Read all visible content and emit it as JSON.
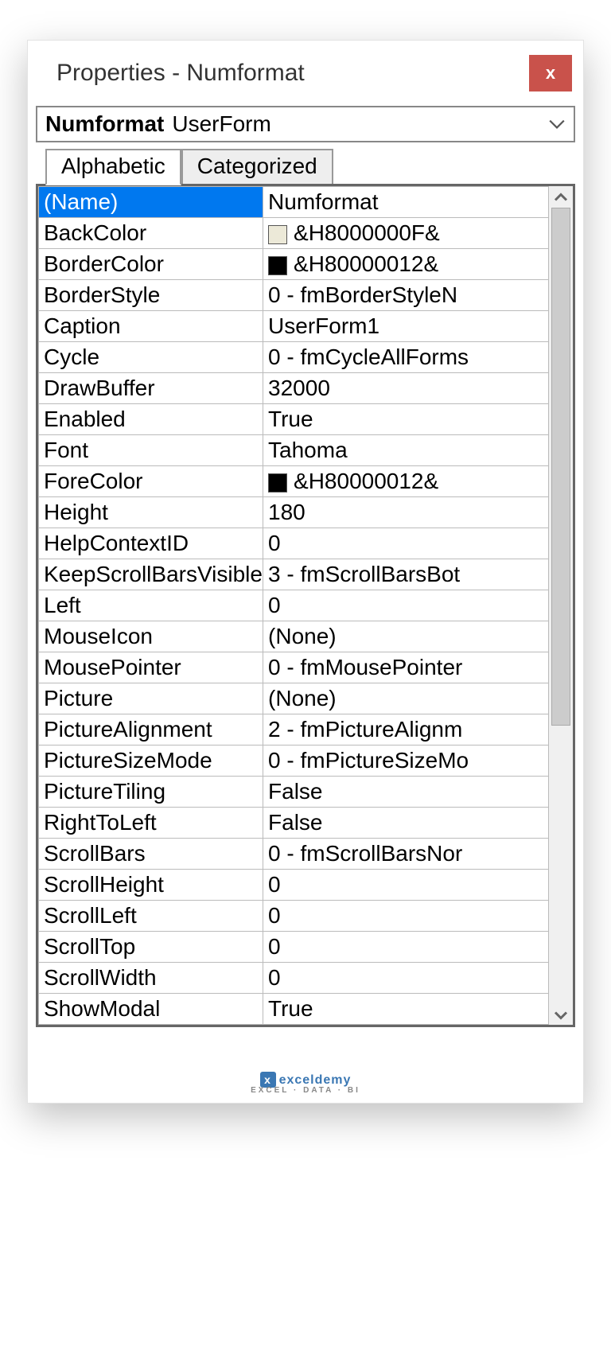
{
  "window": {
    "title": "Properties - Numformat",
    "close_label": "x"
  },
  "object_dropdown": {
    "name": "Numformat",
    "type": "UserForm"
  },
  "tabs": {
    "alphabetic": "Alphabetic",
    "categorized": "Categorized"
  },
  "properties": [
    {
      "name": "(Name)",
      "value": "Numformat",
      "selected": true
    },
    {
      "name": "BackColor",
      "value": "&H8000000F&",
      "swatch": "#ece9d8"
    },
    {
      "name": "BorderColor",
      "value": "&H80000012&",
      "swatch": "#000000"
    },
    {
      "name": "BorderStyle",
      "value": "0 - fmBorderStyleN"
    },
    {
      "name": "Caption",
      "value": "UserForm1"
    },
    {
      "name": "Cycle",
      "value": "0 - fmCycleAllForms"
    },
    {
      "name": "DrawBuffer",
      "value": "32000"
    },
    {
      "name": "Enabled",
      "value": "True"
    },
    {
      "name": "Font",
      "value": "Tahoma"
    },
    {
      "name": "ForeColor",
      "value": "&H80000012&",
      "swatch": "#000000"
    },
    {
      "name": "Height",
      "value": "180"
    },
    {
      "name": "HelpContextID",
      "value": "0"
    },
    {
      "name": "KeepScrollBarsVisible",
      "value": "3 - fmScrollBarsBot"
    },
    {
      "name": "Left",
      "value": "0"
    },
    {
      "name": "MouseIcon",
      "value": "(None)"
    },
    {
      "name": "MousePointer",
      "value": "0 - fmMousePointer"
    },
    {
      "name": "Picture",
      "value": "(None)"
    },
    {
      "name": "PictureAlignment",
      "value": "2 - fmPictureAlignm"
    },
    {
      "name": "PictureSizeMode",
      "value": "0 - fmPictureSizeMo"
    },
    {
      "name": "PictureTiling",
      "value": "False"
    },
    {
      "name": "RightToLeft",
      "value": "False"
    },
    {
      "name": "ScrollBars",
      "value": "0 - fmScrollBarsNor"
    },
    {
      "name": "ScrollHeight",
      "value": "0"
    },
    {
      "name": "ScrollLeft",
      "value": "0"
    },
    {
      "name": "ScrollTop",
      "value": "0"
    },
    {
      "name": "ScrollWidth",
      "value": "0"
    },
    {
      "name": "ShowModal",
      "value": "True"
    }
  ],
  "watermark": {
    "brand": "exceldemy",
    "sub": "EXCEL · DATA · BI"
  }
}
